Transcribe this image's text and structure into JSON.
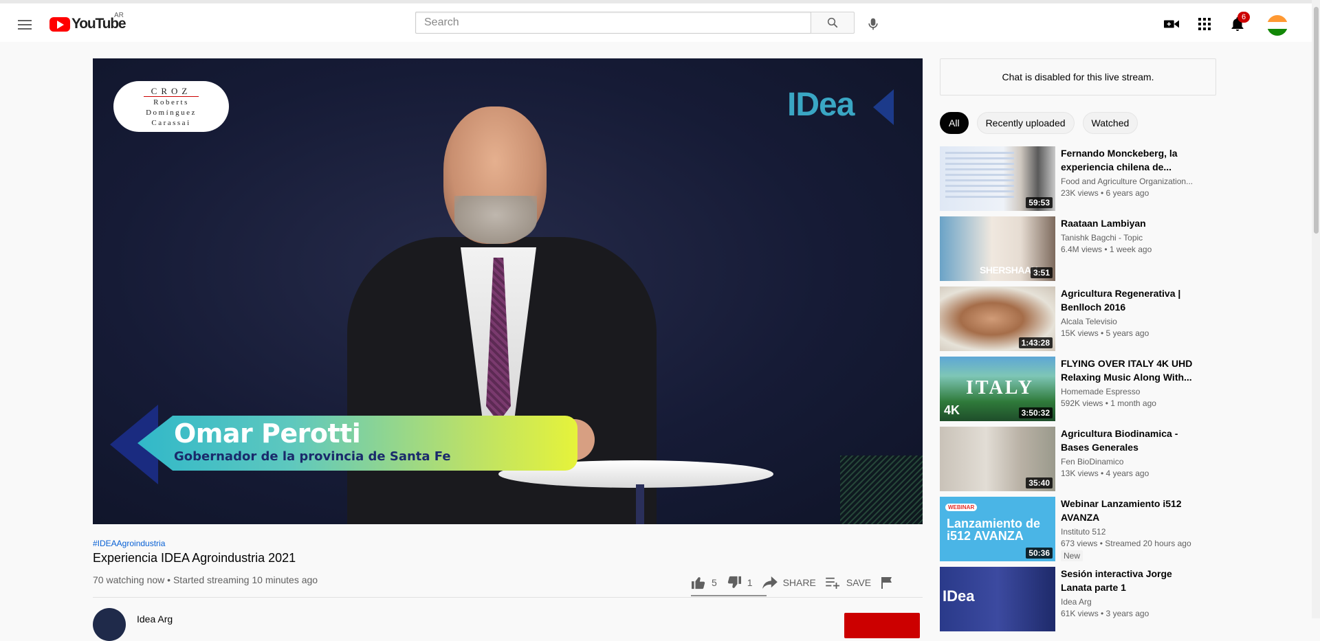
{
  "header": {
    "logo_text": "YouTube",
    "country_code": "AR",
    "search_placeholder": "Search",
    "notification_count": "6"
  },
  "player": {
    "sponsor_line1": "CROZ",
    "sponsor_line2": "Roberts",
    "sponsor_line3": "Domínguez",
    "sponsor_line4": "Carassai",
    "brand_logo": "IDea",
    "lower_third_name": "Omar Perotti",
    "lower_third_title": "Gobernador de la provincia de Santa Fe"
  },
  "video": {
    "hashtag": "#IDEAAgroindustria",
    "title": "Experiencia IDEA Agroindustria 2021",
    "meta": "70 watching now • Started streaming 10 minutes ago",
    "likes": "5",
    "dislikes": "1",
    "share_label": "SHARE",
    "save_label": "SAVE",
    "channel_name": "Idea Arg"
  },
  "sidebar": {
    "chat_disabled": "Chat is disabled for this live stream.",
    "chips": [
      "All",
      "Recently uploaded",
      "Watched"
    ],
    "recommendations": [
      {
        "title": "Fernando Monckeberg, la experiencia chilena de...",
        "channel": "Food and Agriculture Organization...",
        "meta": "23K views • 6 years ago",
        "duration": "59:53"
      },
      {
        "title": "Raataan Lambiyan",
        "channel": "Tanishk Bagchi - Topic",
        "meta": "6.4M views • 1 week ago",
        "duration": "3:51",
        "thumb_text": "SHERSHAAH"
      },
      {
        "title": "Agricultura Regenerativa | Benlloch 2016",
        "channel": "Alcala Televisio",
        "meta": "15K views • 5 years ago",
        "duration": "1:43:28"
      },
      {
        "title": "FLYING OVER ITALY 4K UHD Relaxing Music Along With...",
        "channel": "Homemade Espresso",
        "meta": "592K views • 1 month ago",
        "duration": "3:50:32",
        "thumb_text": "ITALY",
        "thumb_text2": "4K"
      },
      {
        "title": "Agricultura Biodinamica - Bases Generales",
        "channel": "Fen BioDinamico",
        "meta": "13K views • 4 years ago",
        "duration": "35:40"
      },
      {
        "title": "Webinar Lanzamiento i512 AVANZA",
        "channel": "Instituto 512",
        "meta": "673 views • Streamed 20 hours ago",
        "duration": "50:36",
        "badge": "New",
        "thumb_text": "WEBINAR",
        "thumb_text2": "Lanzamiento de i512 AVANZA"
      },
      {
        "title": "Sesión interactiva Jorge Lanata parte 1",
        "channel": "Idea Arg",
        "meta": "61K views • 3 years ago",
        "thumb_text": "IDea"
      }
    ]
  },
  "colors": {
    "brand_red": "#ff0000",
    "link_blue": "#065fd4",
    "chip_active": "#030303"
  }
}
